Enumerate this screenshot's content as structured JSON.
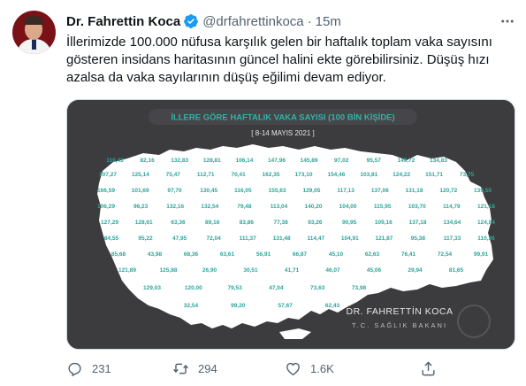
{
  "tweet": {
    "author_name": "Dr. Fahrettin Koca",
    "handle": "@drfahrettinkoca",
    "separator": "·",
    "time": "15m",
    "text_lines": [
      "İllerimizde 100.000 nüfusa karşılık gelen bir haftalık toplam vaka sayısını",
      "gösteren insidans haritasının güncel halini ekte görebilirsiniz. Düşüş hızı",
      "azalsa da vaka sayılarının düşüş eğilimi devam ediyor."
    ]
  },
  "map": {
    "title": "İLLERE GÖRE HAFTALIK VAKA SAYISI (100 BİN KİŞİDE)",
    "date_range": "[ 8-14 MAYIS 2021 ]",
    "signature_name": "DR. FAHRETTİN KOCA",
    "signature_title": "T.C. SAĞLIK BAKANI",
    "map_color": "#ffffff",
    "label_color": "#2ea69a",
    "background_color": "#3c3c3e",
    "accent_color": "#2fb3a5",
    "province_values": [
      "110,43",
      "82,16",
      "132,83",
      "128,81",
      "106,14",
      "147,96",
      "145,89",
      "97,02",
      "95,57",
      "149,72",
      "134,83",
      "107,27",
      "125,14",
      "75,47",
      "112,71",
      "70,41",
      "162,35",
      "173,10",
      "154,46",
      "103,81",
      "124,22",
      "151,71",
      "73,75",
      "166,59",
      "101,69",
      "97,70",
      "130,45",
      "116,05",
      "155,63",
      "129,05",
      "117,13",
      "137,06",
      "131,18",
      "120,72",
      "139,50",
      "106,29",
      "96,23",
      "132,16",
      "132,54",
      "79,48",
      "113,04",
      "140,20",
      "104,00",
      "115,95",
      "103,70",
      "114,79",
      "121,18",
      "127,29",
      "128,61",
      "63,36",
      "89,16",
      "83,86",
      "77,38",
      "93,26",
      "90,95",
      "109,16",
      "137,18",
      "134,64",
      "124,84",
      "84,55",
      "95,22",
      "47,95",
      "72,04",
      "111,37",
      "131,48",
      "114,47",
      "104,91",
      "121,87",
      "95,38",
      "117,33",
      "110,36",
      "85,68",
      "43,98",
      "68,36",
      "63,61",
      "56,91",
      "66,87",
      "45,10",
      "62,63",
      "76,41",
      "72,54",
      "99,91",
      "121,89",
      "125,88",
      "26,90",
      "30,51",
      "41,71",
      "46,07",
      "45,06",
      "29,94",
      "81,65",
      "129,03",
      "120,00",
      "79,53",
      "47,04",
      "73,63",
      "73,98",
      "32,54",
      "99,20",
      "57,67",
      "62,43"
    ]
  },
  "actions": {
    "reply_count": "231",
    "retweet_count": "294",
    "like_count": "1.6K",
    "reply_icon": "reply-icon",
    "retweet_icon": "retweet-icon",
    "like_icon": "heart-icon",
    "share_icon": "share-icon"
  },
  "colors": {
    "text_primary": "#0f1419",
    "text_secondary": "#536471",
    "verified_blue": "#1d9bf0"
  }
}
